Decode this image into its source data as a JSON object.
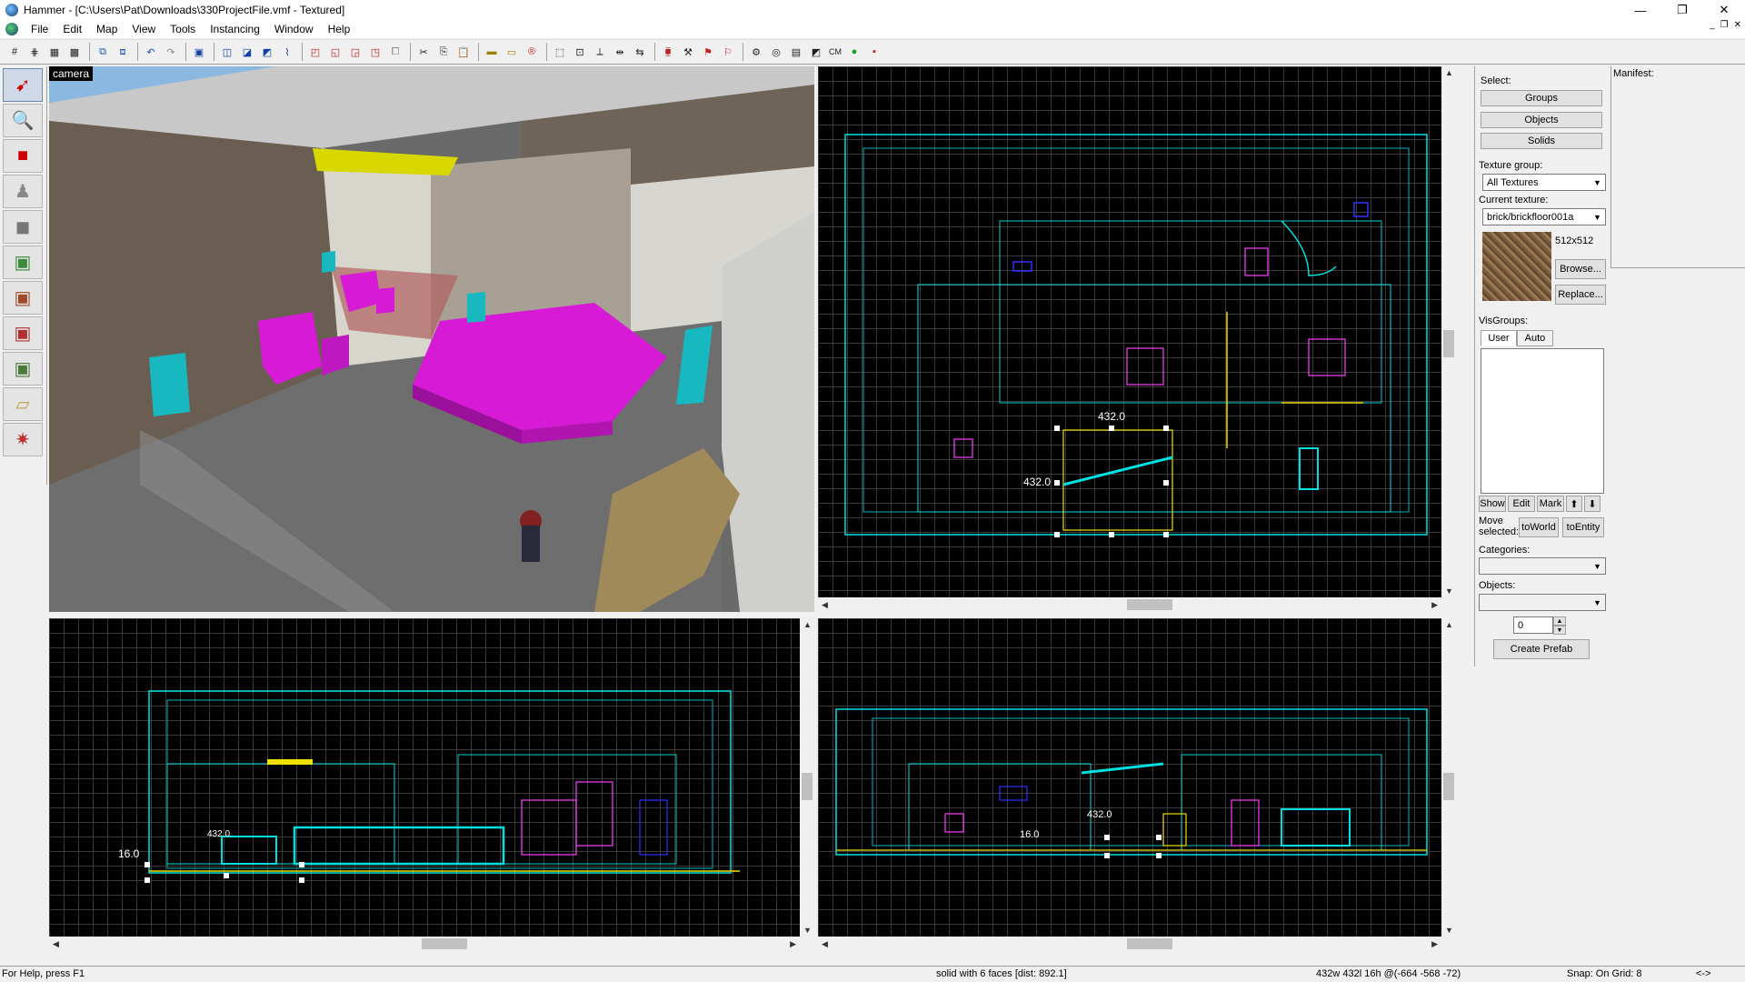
{
  "window": {
    "title": "Hammer - [C:\\Users\\Pat\\Downloads\\330ProjectFile.vmf - Textured]",
    "minimize": "—",
    "maximize": "❐",
    "close": "✕"
  },
  "menu": {
    "items": [
      "File",
      "Edit",
      "Map",
      "View",
      "Tools",
      "Instancing",
      "Window",
      "Help"
    ]
  },
  "toolbar": {
    "cm_label": "CM"
  },
  "viewports": {
    "camera_label": "camera",
    "top_dim_h": "432.0",
    "top_dim_v": "432.0",
    "front_dim": "16.0",
    "front_dim2": "432.0",
    "side_dim": "432.0",
    "side_dim2": "16.0"
  },
  "select_panel": {
    "select_label": "Select:",
    "groups_button": "Groups",
    "objects_button": "Objects",
    "solids_button": "Solids",
    "texture_group_label": "Texture group:",
    "texture_group_value": "All Textures",
    "current_texture_label": "Current texture:",
    "current_texture_value": "brick/brickfloor001a",
    "texture_size": "512x512",
    "browse_button": "Browse...",
    "replace_button": "Replace...",
    "visgroups_label": "VisGroups:",
    "tab_user": "User",
    "tab_auto": "Auto",
    "show_button": "Show",
    "edit_button": "Edit",
    "mark_button": "Mark",
    "move_selected_label": "Move selected:",
    "to_world_button": "toWorld",
    "to_entity_button": "toEntity",
    "categories_label": "Categories:",
    "objects_label": "Objects:",
    "count_value": "0",
    "create_prefab_button": "Create Prefab"
  },
  "manifest": {
    "label": "Manifest:"
  },
  "status": {
    "help": "For Help, press F1",
    "selection": "solid with 6 faces  [dist: 892.1]",
    "dimensions": "432w 432l 16h @(-664 -568 -72)",
    "snap": "Snap: On Grid: 8",
    "extra": "<->"
  },
  "colors": {
    "wire_cyan": "#00e0e0",
    "wire_magenta": "#ff40ff",
    "wire_yellow": "#f0e000",
    "wire_blue": "#3030ff",
    "brush_magenta": "#d61ad6",
    "brush_cyan": "#17b8c0",
    "brush_yellow": "#d8d800"
  }
}
